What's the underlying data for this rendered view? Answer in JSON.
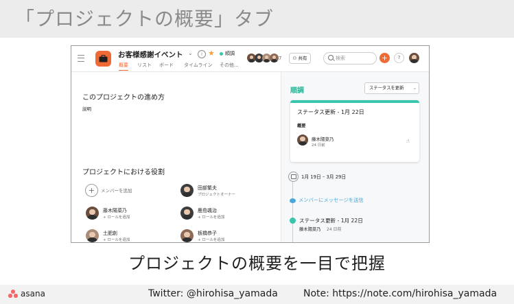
{
  "slide": {
    "title": "「プロジェクトの概要」タブ",
    "caption": "プロジェクトの概要を一目で把握"
  },
  "app": {
    "project_name": "お客様感謝イベント",
    "status_label": "順調",
    "tabs": [
      "概要",
      "リスト",
      "ボード",
      "タイムライン",
      "その他..."
    ],
    "member_count": "7",
    "share_label": "共有",
    "search_placeholder": "検索",
    "help_label": "?"
  },
  "overview": {
    "how_title": "このプロジェクトの進め方",
    "description": "説明",
    "roles_title": "プロジェクトにおける役割",
    "add_member_label": "メンバーを追加",
    "members": [
      {
        "name": "田部繁夫",
        "role": "プロジェクトオーナー"
      },
      {
        "name": "藤木陽菜乃",
        "role": "+ ロールを追加"
      },
      {
        "name": "鹿島颯治",
        "role": "+ ロールを追加"
      },
      {
        "name": "土肥創",
        "role": "+ ロールを追加"
      },
      {
        "name": "板橋恭子",
        "role": "+ ロールを追加"
      }
    ]
  },
  "status_panel": {
    "heading": "順調",
    "update_button": "ステータスを更新",
    "card_title": "ステータス更新 - 1月 22日",
    "card_summary": "概要",
    "card_author": "藤木陽菜乃",
    "card_date": "24 日前",
    "date_range": "1月 19日 – 3月 29日",
    "message_link": "メンバーにメッセージを送信",
    "update_title": "ステータス更新 - 1月 22日",
    "update_author": "藤木陽菜乃",
    "update_when": "24 日前"
  },
  "footer": {
    "logo_text": "asana",
    "twitter": "Twitter: @hirohisa_yamada",
    "note": "Note: https://note.com/hirohisa_yamada"
  },
  "colors": {
    "brand_orange": "#f06a35",
    "status_green": "#37c5ab",
    "link_blue": "#4ba7d8",
    "asana_coral": "#f06a6a"
  }
}
